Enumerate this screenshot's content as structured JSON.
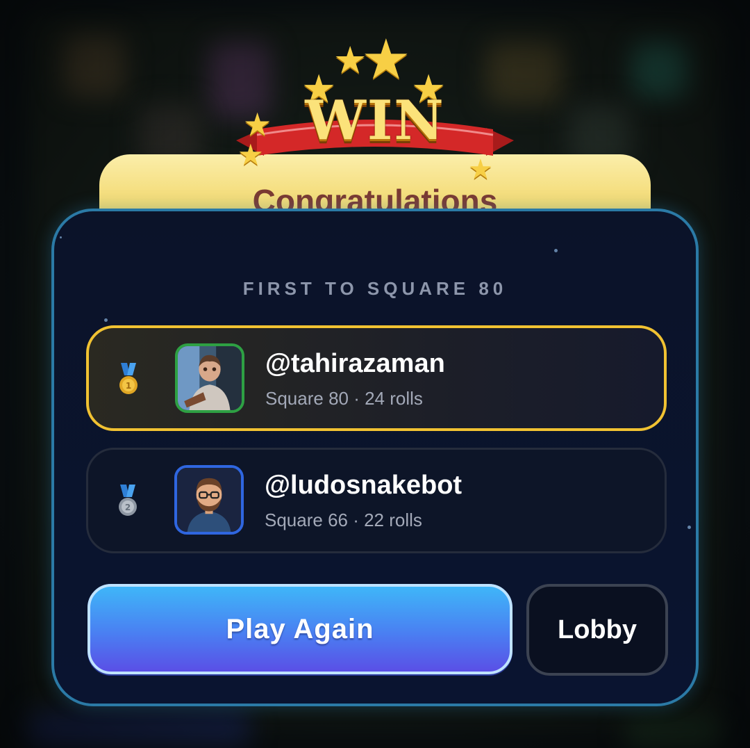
{
  "header": {
    "badge_text": "WIN",
    "congrats_text": "Congratulations"
  },
  "panel": {
    "subtitle": "FIRST TO SQUARE 80",
    "players": [
      {
        "rank": 1,
        "medal": "gold-medal-icon",
        "username": "@tahirazaman",
        "stats": "Square 80 · 24 rolls",
        "avatar": "photo-avatar",
        "highlight_color": "#f1c232"
      },
      {
        "rank": 2,
        "medal": "silver-medal-icon",
        "username": "@ludosnakebot",
        "stats": "Square 66 · 22 rolls",
        "avatar": "cartoon-avatar",
        "highlight_color": "#252c3c"
      }
    ]
  },
  "actions": {
    "play_again": "Play Again",
    "lobby": "Lobby"
  },
  "colors": {
    "panel_border": "#2b7aa6",
    "winner_border": "#f1c232",
    "play_button_top": "#3fb6f8",
    "play_button_bottom": "#5a4fe6"
  }
}
